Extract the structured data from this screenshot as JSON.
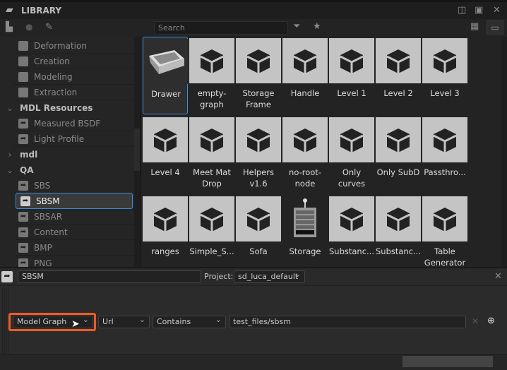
{
  "panel": {
    "title": "LIBRARY"
  },
  "toolbar": {
    "new_folder": "new-folder",
    "new_package": "new-package",
    "edit": "edit"
  },
  "tree": {
    "items": [
      {
        "label": "Deformation",
        "type": "item"
      },
      {
        "label": "Creation",
        "type": "item"
      },
      {
        "label": "Modeling",
        "type": "item"
      },
      {
        "label": "Extraction",
        "type": "item"
      },
      {
        "label": "MDL Resources",
        "type": "group",
        "expanded": true
      },
      {
        "label": "Measured BSDF",
        "type": "item"
      },
      {
        "label": "Light Profile",
        "type": "item"
      },
      {
        "label": "mdl",
        "type": "group",
        "expanded": false
      },
      {
        "label": "QA",
        "type": "group",
        "expanded": true
      },
      {
        "label": "SBS",
        "type": "item"
      },
      {
        "label": "SBSM",
        "type": "item",
        "selected": true
      },
      {
        "label": "SBSAR",
        "type": "item"
      },
      {
        "label": "Content",
        "type": "item"
      },
      {
        "label": "BMP",
        "type": "item"
      },
      {
        "label": "PNG",
        "type": "item"
      }
    ]
  },
  "search": {
    "placeholder": "Search"
  },
  "grid": {
    "items": [
      {
        "label": "Drawer",
        "selected": true,
        "thumb": "drawer"
      },
      {
        "label": "empty-graph"
      },
      {
        "label": "Storage Frame"
      },
      {
        "label": "Handle"
      },
      {
        "label": "Level 1"
      },
      {
        "label": "Level 2"
      },
      {
        "label": "Level 3"
      },
      {
        "label": "Level 4"
      },
      {
        "label": "Meet Mat Drop"
      },
      {
        "label": "Helpers v1.6"
      },
      {
        "label": "no-root-node"
      },
      {
        "label": "Only curves"
      },
      {
        "label": "Only SubD"
      },
      {
        "label": "Passthro..."
      },
      {
        "label": "ranges"
      },
      {
        "label": "Simple_S..."
      },
      {
        "label": "Sofa"
      },
      {
        "label": "Storage",
        "thumb": "storage"
      },
      {
        "label": "Substanc..."
      },
      {
        "label": "Substanc..."
      },
      {
        "label": "Table Generator"
      }
    ]
  },
  "bottom": {
    "name": "SBSM",
    "project_label": "Project:",
    "project": "sd_luca_default",
    "filter": {
      "type": "Model Graph",
      "field": "Url",
      "op": "Contains",
      "value": "test_files/sbsm"
    }
  },
  "colors": {
    "accent": "#3b8de0",
    "highlight": "#f05a28"
  }
}
